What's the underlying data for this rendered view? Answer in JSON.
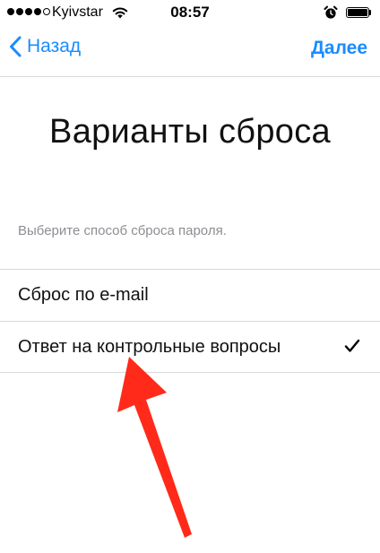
{
  "status_bar": {
    "carrier": "Kyivstar",
    "time": "08:57",
    "signal_filled": 4,
    "signal_total": 5
  },
  "nav": {
    "back_label": "Назад",
    "next_label": "Далее"
  },
  "title": "Варианты сброса",
  "section_header": "Выберите способ сброса пароля.",
  "options": [
    {
      "label": "Сброс по e-mail",
      "selected": false
    },
    {
      "label": "Ответ на контрольные вопросы",
      "selected": true
    }
  ],
  "colors": {
    "accent": "#1a8cff",
    "annotation_arrow": "#ff2a1a",
    "separator": "#d9d9d9",
    "secondary_text": "#8e8e93"
  },
  "icons": {
    "back": "chevron-left-icon",
    "check": "checkmark-icon",
    "wifi": "wifi-icon",
    "alarm": "alarm-clock-icon",
    "battery": "battery-icon"
  }
}
